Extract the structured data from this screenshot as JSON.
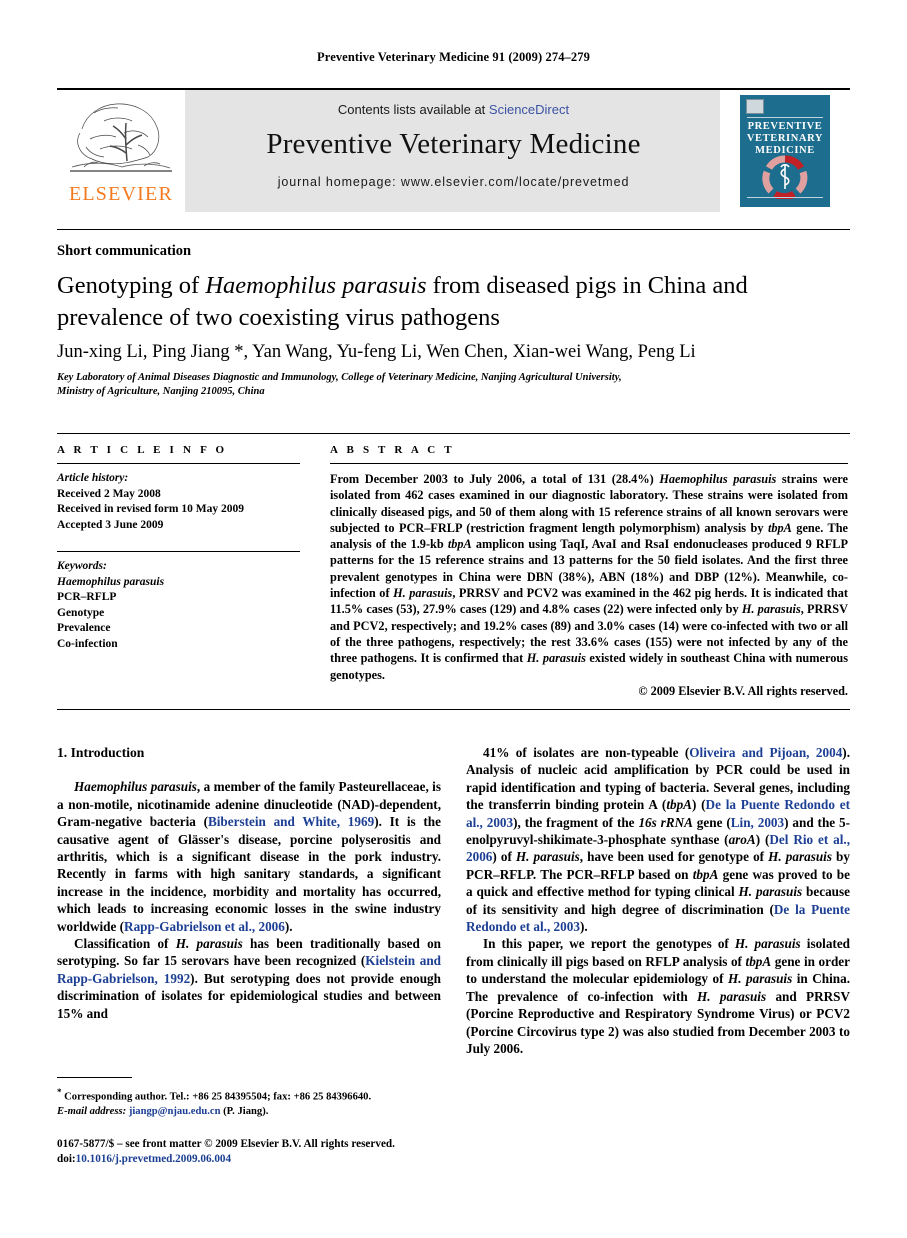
{
  "running_head": "Preventive Veterinary Medicine 91 (2009) 274–279",
  "masthead": {
    "contents_prefix": "Contents lists available at ",
    "sciencedirect": "ScienceDirect",
    "journal_title": "Preventive Veterinary Medicine",
    "homepage": "journal homepage: www.elsevier.com/locate/prevetmed",
    "publisher": "ELSEVIER",
    "cover_line1": "PREVENTIVE",
    "cover_line2": "VETERINARY",
    "cover_line3": "MEDICINE",
    "colors": {
      "band": "#e4e4e4",
      "link": "#3b53a4",
      "elsevier_orange": "#f47a20",
      "cover_blue": "#1d6d8e",
      "cover_ring_light": "#e0a0a0",
      "cover_ring_dark": "#c02026"
    }
  },
  "article": {
    "type": "Short communication",
    "title_part1": "Genotyping of ",
    "title_italic1": "Haemophilus parasuis",
    "title_part2": " from diseased pigs in China and prevalence of two coexisting virus pathogens",
    "authors": "Jun-xing Li, Ping Jiang *, Yan Wang, Yu-feng Li, Wen Chen, Xian-wei Wang, Peng Li",
    "affiliation_line1": "Key Laboratory of Animal Diseases Diagnostic and Immunology, College of Veterinary Medicine, Nanjing Agricultural University,",
    "affiliation_line2": "Ministry of Agriculture, Nanjing 210095, China"
  },
  "article_info": {
    "heading": "A R T I C L E   I N F O",
    "history_label": "Article history:",
    "history": [
      "Received 2 May 2008",
      "Received in revised form 10 May 2009",
      "Accepted 3 June 2009"
    ],
    "keywords_label": "Keywords:",
    "keywords": [
      "Haemophilus parasuis",
      "PCR–RFLP",
      "Genotype",
      "Prevalence",
      "Co-infection"
    ]
  },
  "abstract": {
    "heading": "A B S T R A C T",
    "text": "From December 2003 to July 2006, a total of 131 (28.4%) Haemophilus parasuis strains were isolated from 462 cases examined in our diagnostic laboratory. These strains were isolated from clinically diseased pigs, and 50 of them along with 15 reference strains of all known serovars were subjected to PCR–FRLP (restriction fragment length polymorphism) analysis by tbpA gene. The analysis of the 1.9-kb tbpA amplicon using TaqI, AvaI and RsaI endonucleases produced 9 RFLP patterns for the 15 reference strains and 13 patterns for the 50 field isolates. And the first three prevalent genotypes in China were DBN (38%), ABN (18%) and DBP (12%). Meanwhile, co-infection of H. parasuis, PRRSV and PCV2 was examined in the 462 pig herds. It is indicated that 11.5% cases (53), 27.9% cases (129) and 4.8% cases (22) were infected only by H. parasuis, PRRSV and PCV2, respectively; and 19.2% cases (89) and 3.0% cases (14) were co-infected with two or all of the three pathogens, respectively; the rest 33.6% cases (155) were not infected by any of the three pathogens. It is confirmed that H. parasuis existed widely in southeast China with numerous genotypes.",
    "copyright": "© 2009 Elsevier B.V. All rights reserved."
  },
  "body": {
    "section_heading": "1. Introduction",
    "left_paragraphs": [
      "Haemophilus parasuis, a member of the family Pasteurellaceae, is a non-motile, nicotinamide adenine dinucleotide (NAD)-dependent, Gram-negative bacteria (Biberstein and White, 1969). It is the causative agent of Glässer's disease, porcine polyserositis and arthritis, which is a significant disease in the pork industry. Recently in farms with high sanitary standards, a significant increase in the incidence, morbidity and mortality has occurred, which leads to increasing economic losses in the swine industry worldwide (Rapp-Gabrielson et al., 2006).",
      "Classification of H. parasuis has been traditionally based on serotyping. So far 15 serovars have been recognized (Kielstein and Rapp-Gabrielson, 1992). But serotyping does not provide enough discrimination of isolates for epidemiological studies and between 15% and"
    ],
    "right_paragraphs": [
      "41% of isolates are non-typeable (Oliveira and Pijoan, 2004). Analysis of nucleic acid amplification by PCR could be used in rapid identification and typing of bacteria. Several genes, including the transferrin binding protein A (tbpA) (De la Puente Redondo et al., 2003), the fragment of the 16s rRNA gene (Lin, 2003) and the 5-enolpyruvyl-shikimate-3-phosphate synthase (aroA) (Del Rio et al., 2006) of H. parasuis, have been used for genotype of H. parasuis by PCR–RFLP. The PCR–RFLP based on tbpA gene was proved to be a quick and effective method for typing clinical H. parasuis because of its sensitivity and high degree of discrimination (De la Puente Redondo et al., 2003).",
      "In this paper, we report the genotypes of H. parasuis isolated from clinically ill pigs based on RFLP analysis of tbpA gene in order to understand the molecular epidemiology of H. parasuis in China. The prevalence of co-infection with H. parasuis and PRRSV (Porcine Reproductive and Respiratory Syndrome Virus) or PCV2 (Porcine Circovirus type 2) was also studied from December 2003 to July 2006."
    ]
  },
  "footnotes": {
    "corresponding": "Corresponding author. Tel.: +86 25 84395504; fax: +86 25 84396640.",
    "email_label": "E-mail address:",
    "email": "jiangp@njau.edu.cn",
    "email_suffix": "(P. Jiang).",
    "colophon": "0167-5877/$ – see front matter © 2009 Elsevier B.V. All rights reserved.",
    "doi_prefix": "doi:",
    "doi": "10.1016/j.prevetmed.2009.06.004"
  }
}
